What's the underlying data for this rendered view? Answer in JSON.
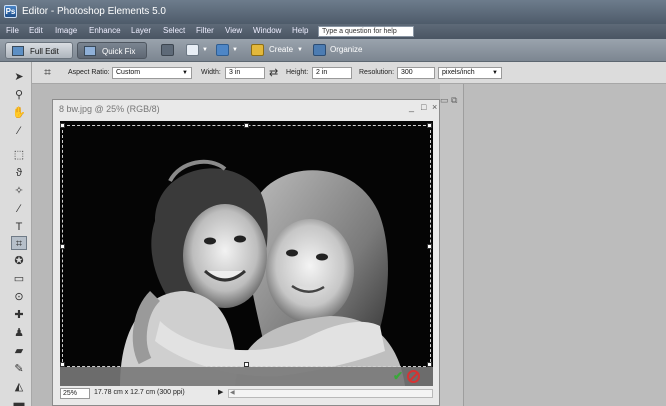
{
  "window": {
    "title": "Editor - Photoshop Elements 5.0",
    "icon": "photoshop-elements-icon"
  },
  "menu": {
    "items": [
      "File",
      "Edit",
      "Image",
      "Enhance",
      "Layer",
      "Select",
      "Filter",
      "View",
      "Window",
      "Help"
    ],
    "help_placeholder": "Type a question for help"
  },
  "shortcuts": {
    "full_edit": "Full Edit",
    "quick_fix": "Quick Fix",
    "create": "Create",
    "organize": "Organize"
  },
  "options": {
    "aspect_ratio_label": "Aspect Ratio:",
    "aspect_ratio_value": "Custom",
    "width_label": "Width:",
    "width_value": "3 in",
    "height_label": "Height:",
    "height_value": "2 in",
    "resolution_label": "Resolution:",
    "resolution_value": "300",
    "resolution_unit": "pixels/inch"
  },
  "document": {
    "title": "8 bw.jpg @ 25% (RGB/8)",
    "zoom": "25%",
    "info": "17.78 cm x 12.7 cm (300 ppi)"
  },
  "colors": {
    "titlebar": "#5a6878",
    "commit": "#39a839",
    "cancel": "#d53333"
  }
}
